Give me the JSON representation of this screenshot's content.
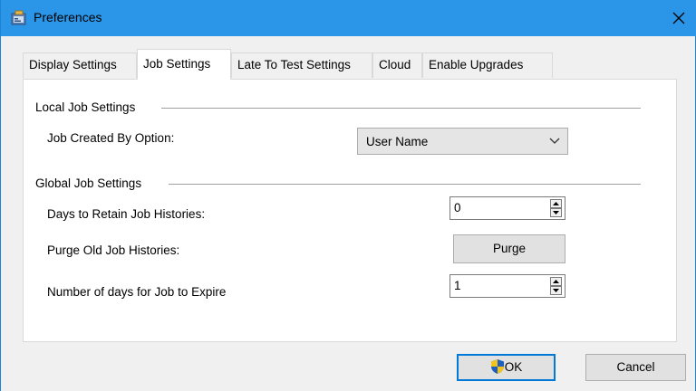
{
  "window": {
    "title": "Preferences"
  },
  "tabs": [
    {
      "label": "Display Settings"
    },
    {
      "label": "Job Settings"
    },
    {
      "label": "Late To Test Settings"
    },
    {
      "label": "Cloud"
    },
    {
      "label": "Enable Upgrades"
    }
  ],
  "active_tab": "Job Settings",
  "local": {
    "group_label": "Local Job Settings",
    "created_by_label": "Job Created By Option:",
    "created_by_value": "User Name"
  },
  "global": {
    "group_label": "Global Job Settings",
    "retain_label": "Days to Retain Job Histories:",
    "retain_value": "0",
    "purge_label": "Purge Old Job Histories:",
    "purge_button": "Purge",
    "expire_label": "Number of days for Job to Expire",
    "expire_value": "1"
  },
  "footer": {
    "ok_label": "OK",
    "cancel_label": "Cancel"
  },
  "colors": {
    "titlebar": "#2b95e8",
    "dialog_bg": "#f0f0f0",
    "panel_bg": "#ffffff",
    "primary_border": "#0078d7"
  },
  "icons": {
    "title": "preferences-window-icon",
    "close": "close-icon",
    "dropdown": "chevron-down-icon",
    "ok": "uac-shield-icon"
  }
}
